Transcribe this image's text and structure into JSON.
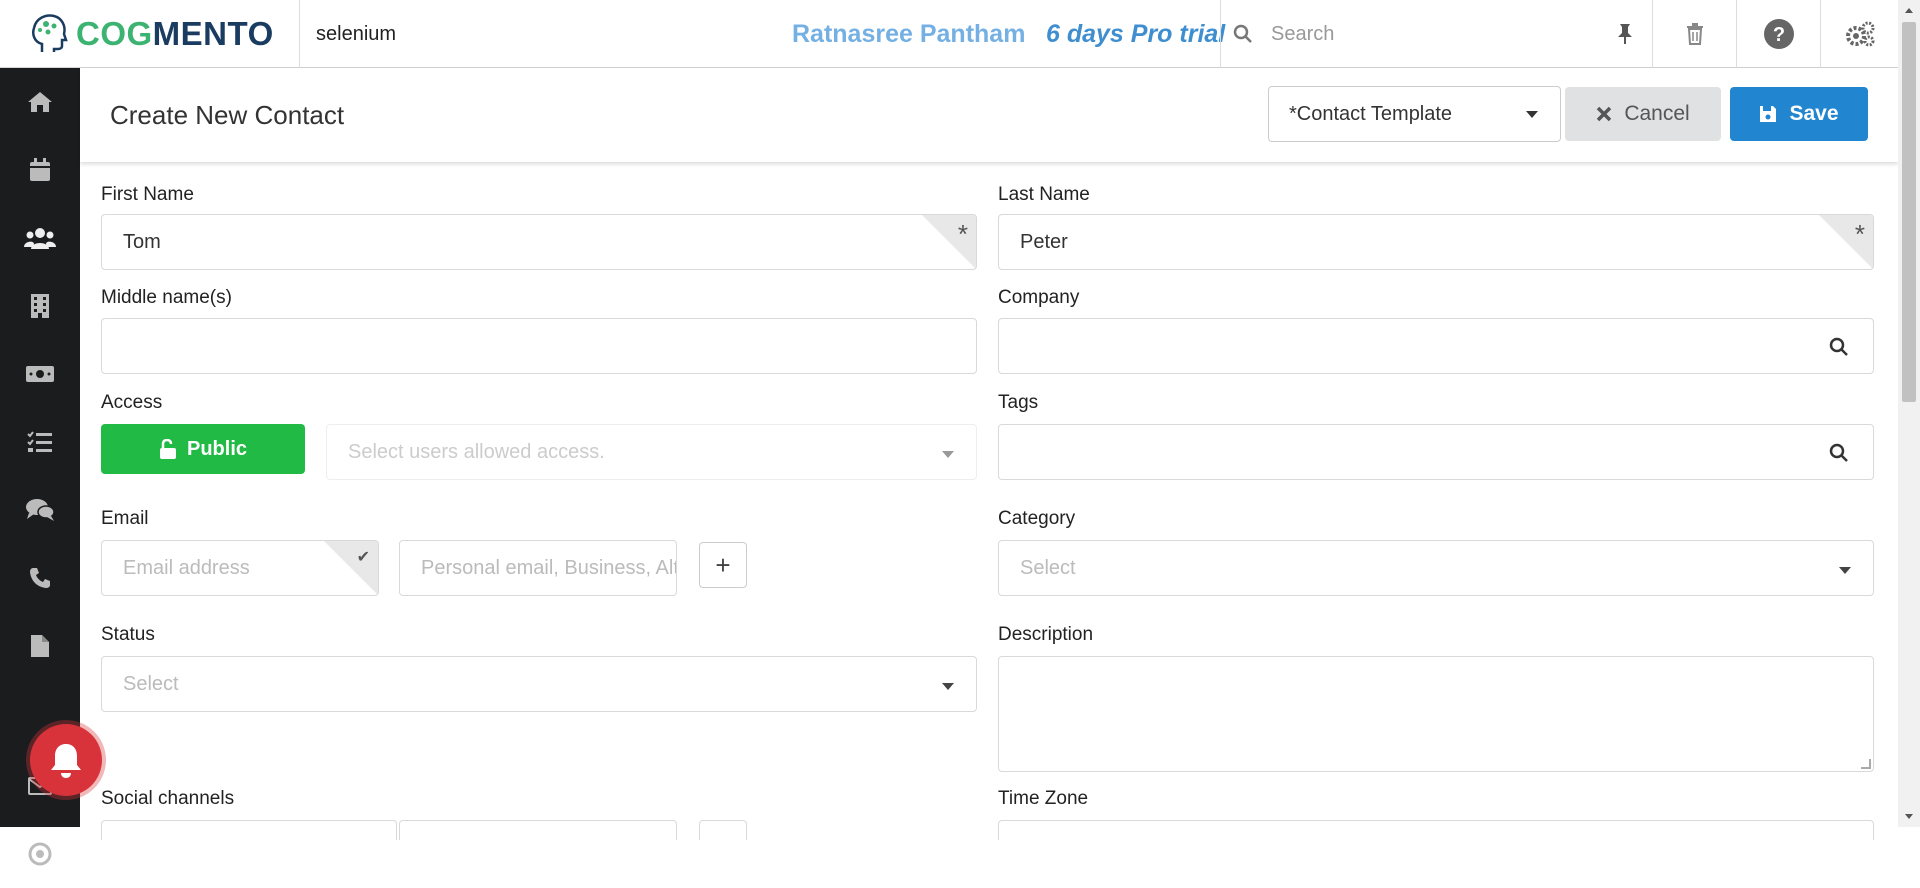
{
  "app": {
    "brand": "COGMENTO",
    "company": "selenium",
    "user_name": "Ratnasree Pantham",
    "trial": "6 days Pro trial",
    "search_placeholder": "Search"
  },
  "header": {
    "title": "Create New Contact",
    "template": "*Contact Template",
    "cancel_label": "Cancel",
    "save_label": "Save"
  },
  "sidebar": {
    "items": [
      "home-icon",
      "calendar-icon",
      "contacts-icon",
      "companies-icon",
      "deals-icon",
      "tasks-icon",
      "cases-icon",
      "calls-icon",
      "documents-icon",
      "email-icon",
      "campaigns-icon"
    ]
  },
  "form": {
    "first_name": {
      "label": "First Name",
      "value": "Tom"
    },
    "last_name": {
      "label": "Last Name",
      "value": "Peter"
    },
    "middle_name": {
      "label": "Middle name(s)",
      "value": ""
    },
    "company": {
      "label": "Company",
      "value": ""
    },
    "access": {
      "label": "Access",
      "button": "Public",
      "placeholder": "Select users allowed access."
    },
    "tags": {
      "label": "Tags",
      "value": ""
    },
    "email": {
      "label": "Email",
      "placeholder": "Email address",
      "type_placeholder": "Personal email, Business, Alt..."
    },
    "category": {
      "label": "Category",
      "placeholder": "Select"
    },
    "status": {
      "label": "Status",
      "placeholder": "Select"
    },
    "description": {
      "label": "Description",
      "value": ""
    },
    "social": {
      "label": "Social channels"
    },
    "timezone": {
      "label": "Time Zone"
    }
  },
  "colors": {
    "accent": "#2185d0",
    "public_green": "#21ba45",
    "sidebar_bg": "#1b1c1d",
    "notification_red": "#d8333a"
  }
}
